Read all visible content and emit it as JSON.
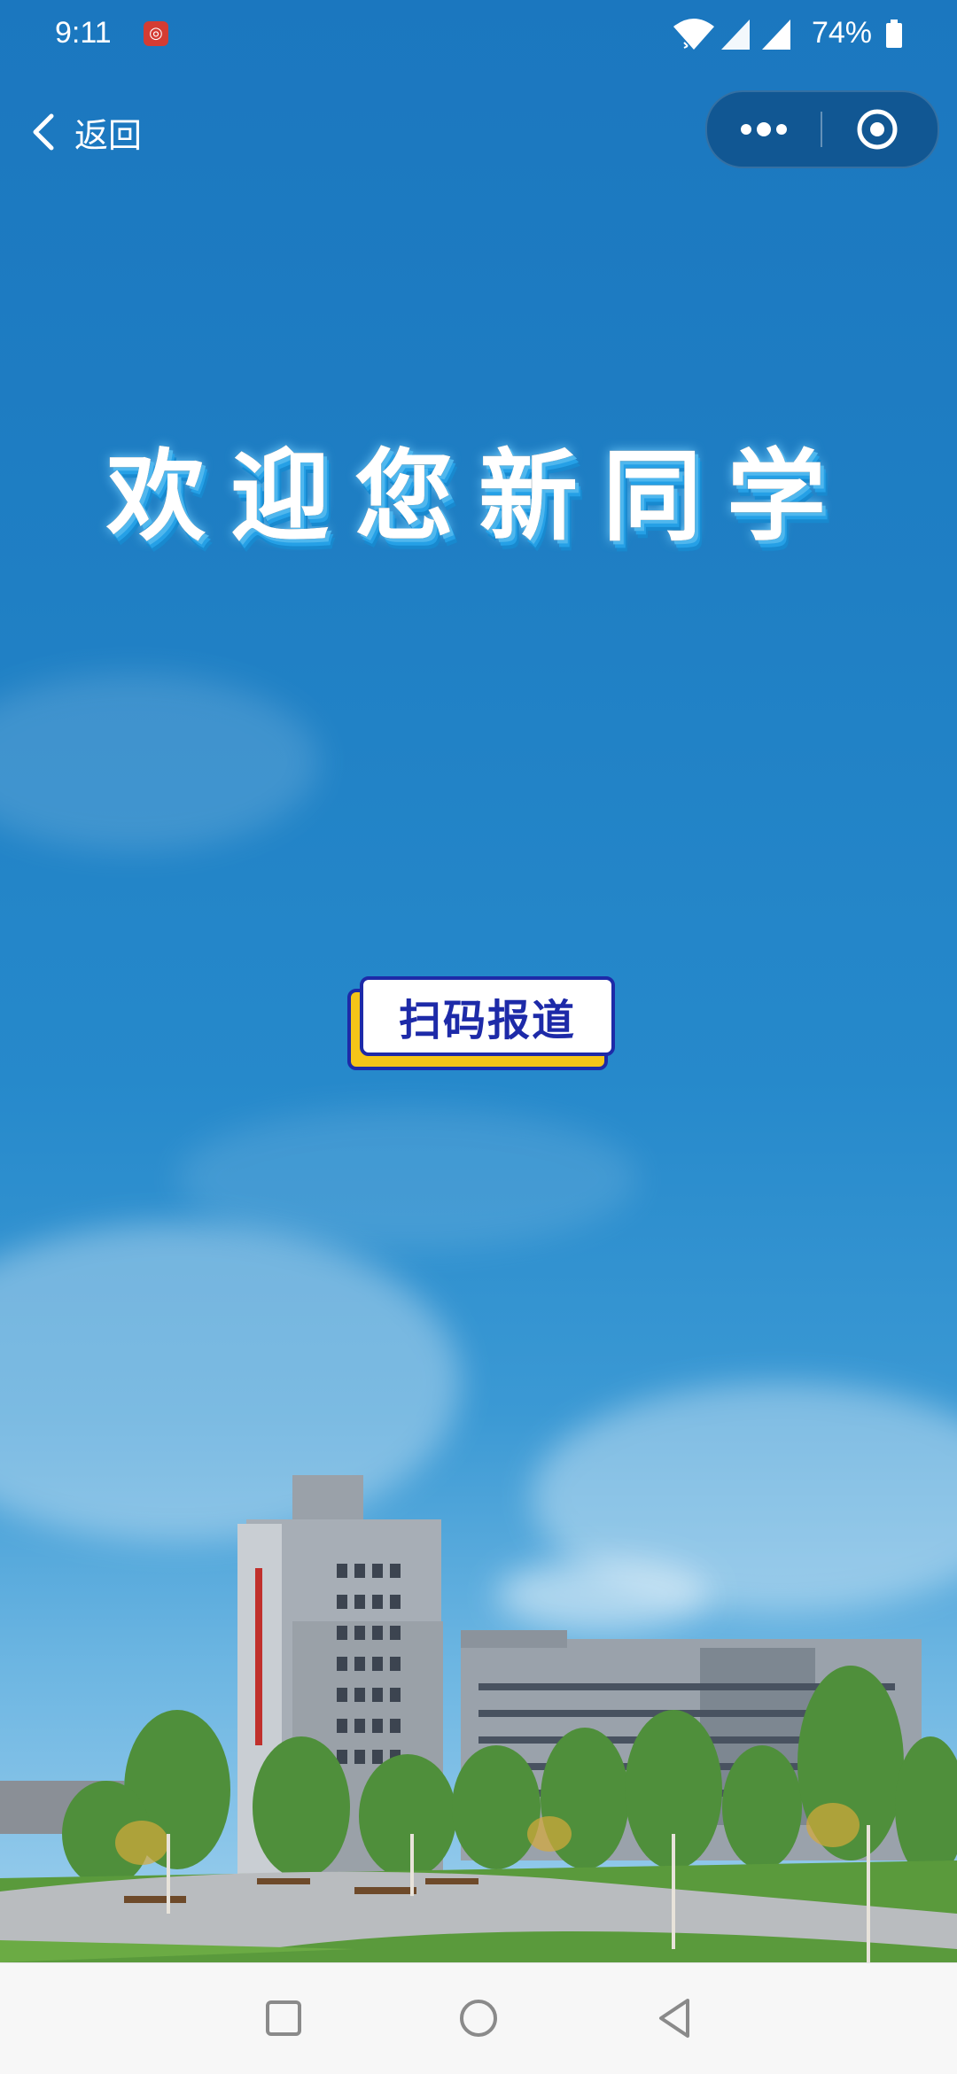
{
  "status_bar": {
    "time": "9:11",
    "notification_icon": "netease-music-icon",
    "wifi_icon": "wifi-icon",
    "signal_icon": "cell-signal-icon",
    "battery_percent": "74%",
    "battery_icon": "battery-icon"
  },
  "nav": {
    "back_label": "返回",
    "back_icon": "chevron-left-icon",
    "capsule_more_icon": "more-dots-icon",
    "capsule_close_icon": "target-close-icon"
  },
  "main": {
    "headline": "欢迎您新同学",
    "scan_button_label": "扫码报道"
  },
  "system_nav": {
    "recents_icon": "square-recents-icon",
    "home_icon": "circle-home-icon",
    "back_icon": "triangle-back-icon"
  },
  "colors": {
    "sky_top": "#1b77bf",
    "headline_glow": "#25a0e6",
    "button_border": "#1d2aa8",
    "button_accent": "#f5c518"
  }
}
